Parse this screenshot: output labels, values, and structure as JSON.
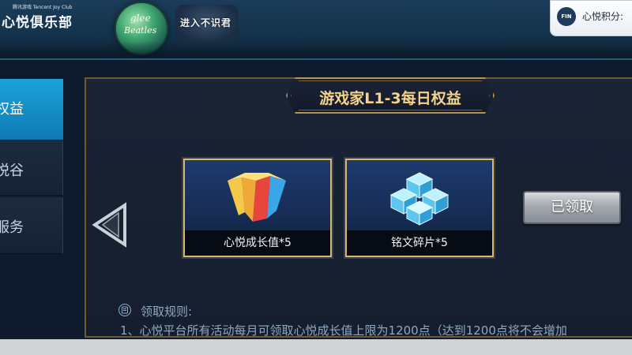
{
  "header": {
    "logo_sub": "腾讯游戏 Tencent Joy Club",
    "logo_main": "心悦俱乐部",
    "badge_glee_line1": "glee",
    "badge_glee_line2": "Beatles",
    "badge_game_text": "进入不识君",
    "points_icon": "FIN",
    "points_label": "心悦积分:"
  },
  "sidebar": {
    "items": [
      {
        "label": "权益",
        "active": true
      },
      {
        "label": "悦谷",
        "active": false
      },
      {
        "label": "服务",
        "active": false
      }
    ]
  },
  "main": {
    "title": "游戏家L1-3每日权益",
    "rewards": [
      {
        "label": "心悦成长值*5",
        "icon": "growth-gem-icon"
      },
      {
        "label": "铭文碎片*5",
        "icon": "inscription-cubes-icon"
      }
    ],
    "claim_button": "已领取",
    "rules_title": "领取规则:",
    "rules_line1": "1、心悦平台所有活动每月可领取心悦成长值上限为1200点（达到1200点将不会增加"
  },
  "colors": {
    "accent_blue": "#1aa3d9",
    "gold_border": "#d6b96a",
    "title_gold": "#f5d38a"
  }
}
